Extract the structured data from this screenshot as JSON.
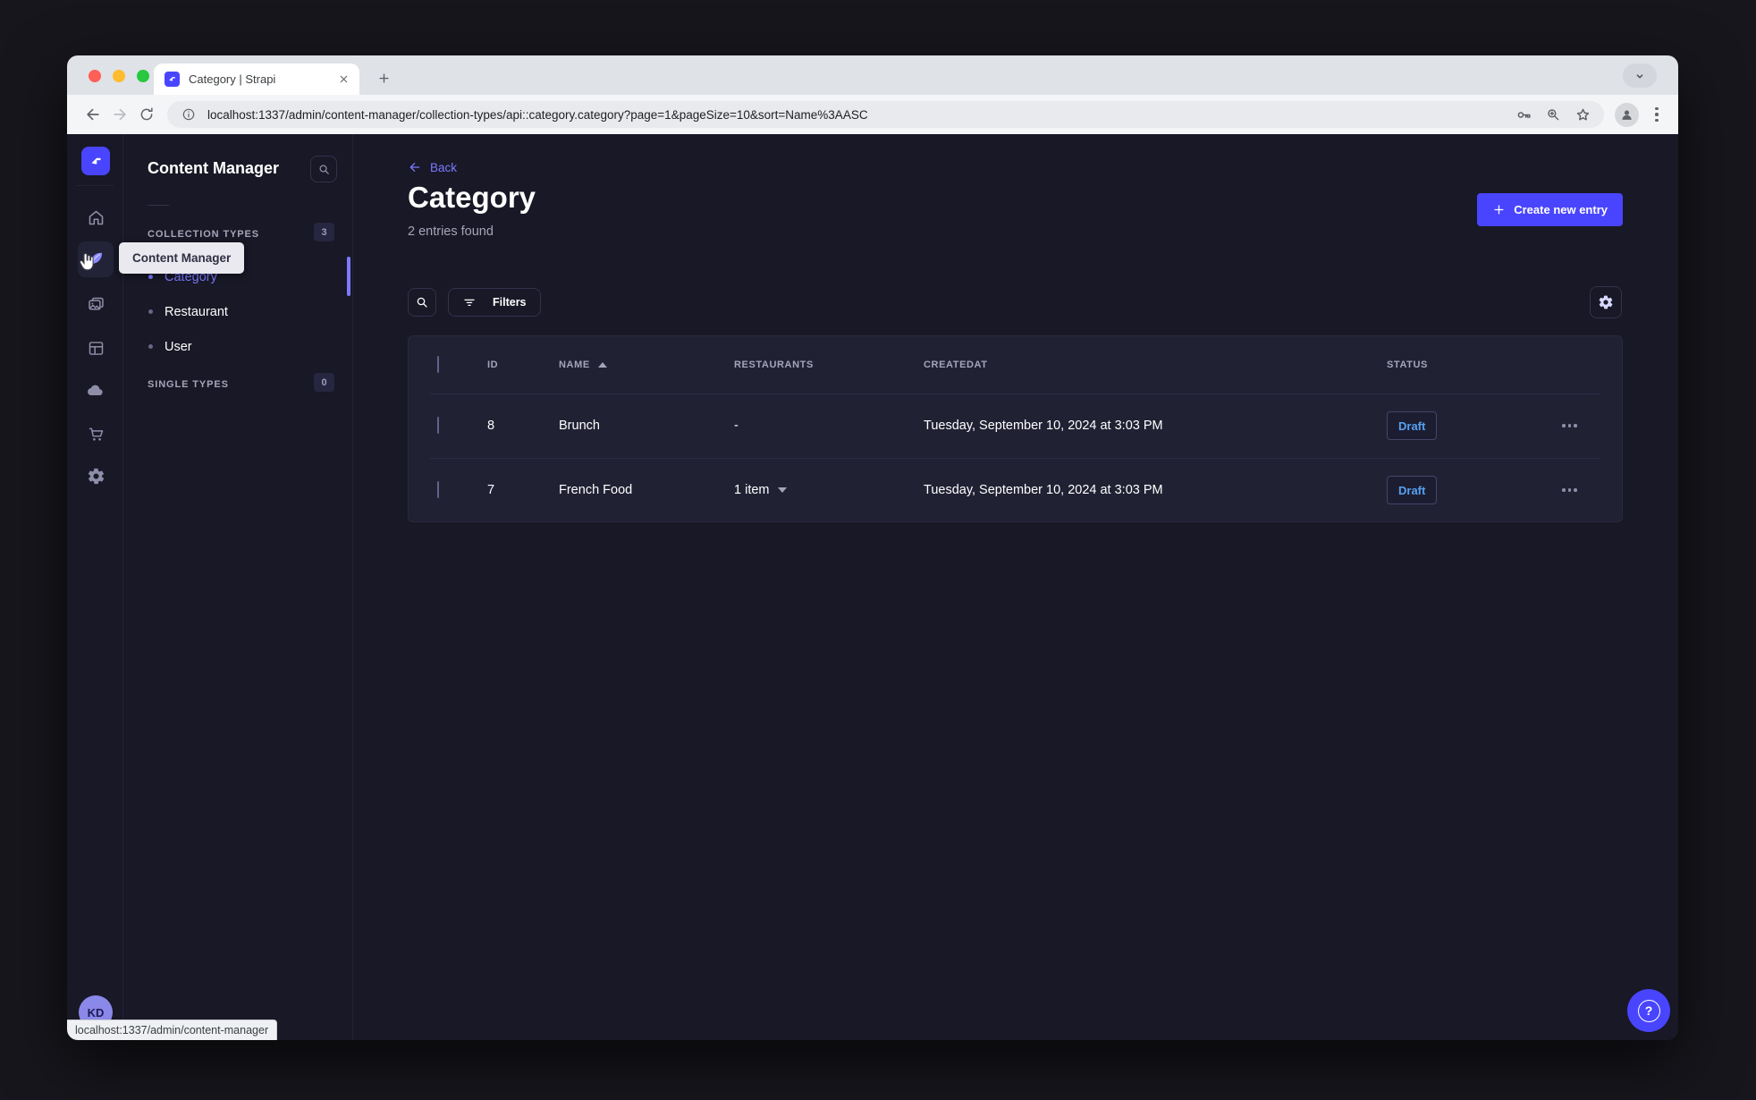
{
  "colors": {
    "primary": "#4945ff",
    "link_purple": "#7b79ff",
    "draft_blue": "#55a1f1",
    "app_bg": "#181826",
    "card_bg": "#212134"
  },
  "icons": {
    "tab_favicon": "strapi-logo",
    "browser": [
      "back-arrow",
      "forward-arrow",
      "reload",
      "info-circle",
      "password-key",
      "zoom-magnifier",
      "bookmark-star",
      "profile-person",
      "menu-vertical-dots",
      "chevron-down"
    ],
    "rail": [
      "strapi-logo",
      "home",
      "content-manager-feather",
      "media-library-images",
      "content-type-builder-layout",
      "cloud",
      "marketplace-cart",
      "settings-gear"
    ],
    "main": [
      "back-arrow",
      "plus",
      "search-magnifier",
      "filter-lines",
      "gear",
      "sort-asc-triangle",
      "chevron-down",
      "row-actions-dots",
      "question-mark-circle"
    ]
  },
  "browser": {
    "tab_title": "Category | Strapi",
    "url": "localhost:1337/admin/content-manager/collection-types/api::category.category?page=1&pageSize=10&sort=Name%3AASC"
  },
  "sidebar": {
    "title": "Content Manager",
    "tooltip": "Content Manager",
    "collection_types": {
      "label": "COLLECTION TYPES",
      "badge": "3"
    },
    "items": [
      {
        "label": "Category",
        "active": true
      },
      {
        "label": "Restaurant",
        "active": false
      },
      {
        "label": "User",
        "active": false
      }
    ],
    "single_types": {
      "label": "SINGLE TYPES",
      "badge": "0"
    }
  },
  "main": {
    "back_label": "Back",
    "title": "Category",
    "subtitle": "2 entries found",
    "create_button": "Create new entry",
    "filters_button": "Filters"
  },
  "table": {
    "headers": {
      "id": "ID",
      "name": "NAME",
      "restaurants": "RESTAURANTS",
      "createdat": "CREATEDAT",
      "status": "STATUS"
    },
    "sort": {
      "column": "NAME",
      "direction": "ascending"
    },
    "rows": [
      {
        "id": "8",
        "name": "Brunch",
        "restaurants": "-",
        "createdat": "Tuesday, September 10, 2024 at 3:03 PM",
        "status": "Draft"
      },
      {
        "id": "7",
        "name": "French Food",
        "restaurants": "1 item",
        "createdat": "Tuesday, September 10, 2024 at 3:03 PM",
        "status": "Draft"
      }
    ]
  },
  "footer": {
    "avatar_initials": "KD",
    "status_bar": "localhost:1337/admin/content-manager"
  }
}
